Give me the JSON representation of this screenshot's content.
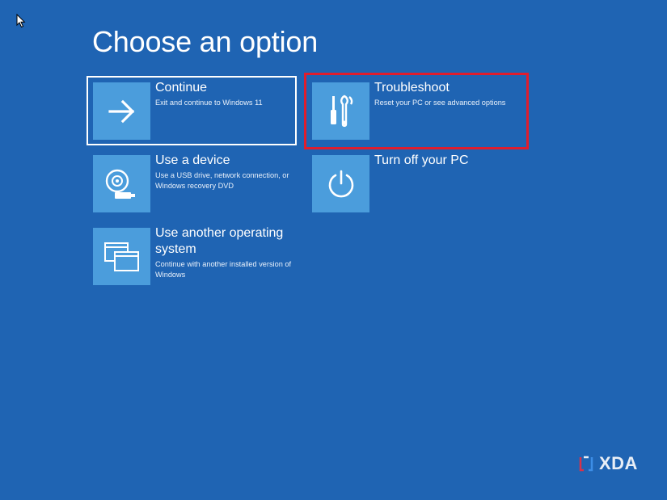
{
  "title": "Choose an option",
  "options": [
    {
      "label": "Continue",
      "description": "Exit and continue to Windows 11",
      "icon": "arrow-right-icon"
    },
    {
      "label": "Troubleshoot",
      "description": "Reset your PC or see advanced options",
      "icon": "tools-icon"
    },
    {
      "label": "Use a device",
      "description": "Use a USB drive, network connection, or Windows recovery DVD",
      "icon": "disc-drive-icon"
    },
    {
      "label": "Turn off your PC",
      "description": "",
      "icon": "power-icon"
    },
    {
      "label": "Use another operating system",
      "description": "Continue with another installed version of Windows",
      "icon": "windows-stack-icon"
    }
  ],
  "watermark": {
    "text": "XDA"
  },
  "colors": {
    "background": "#1f64b3",
    "tile": "#4b9ddc",
    "highlight": "#e01d2d",
    "text": "#ffffff"
  }
}
